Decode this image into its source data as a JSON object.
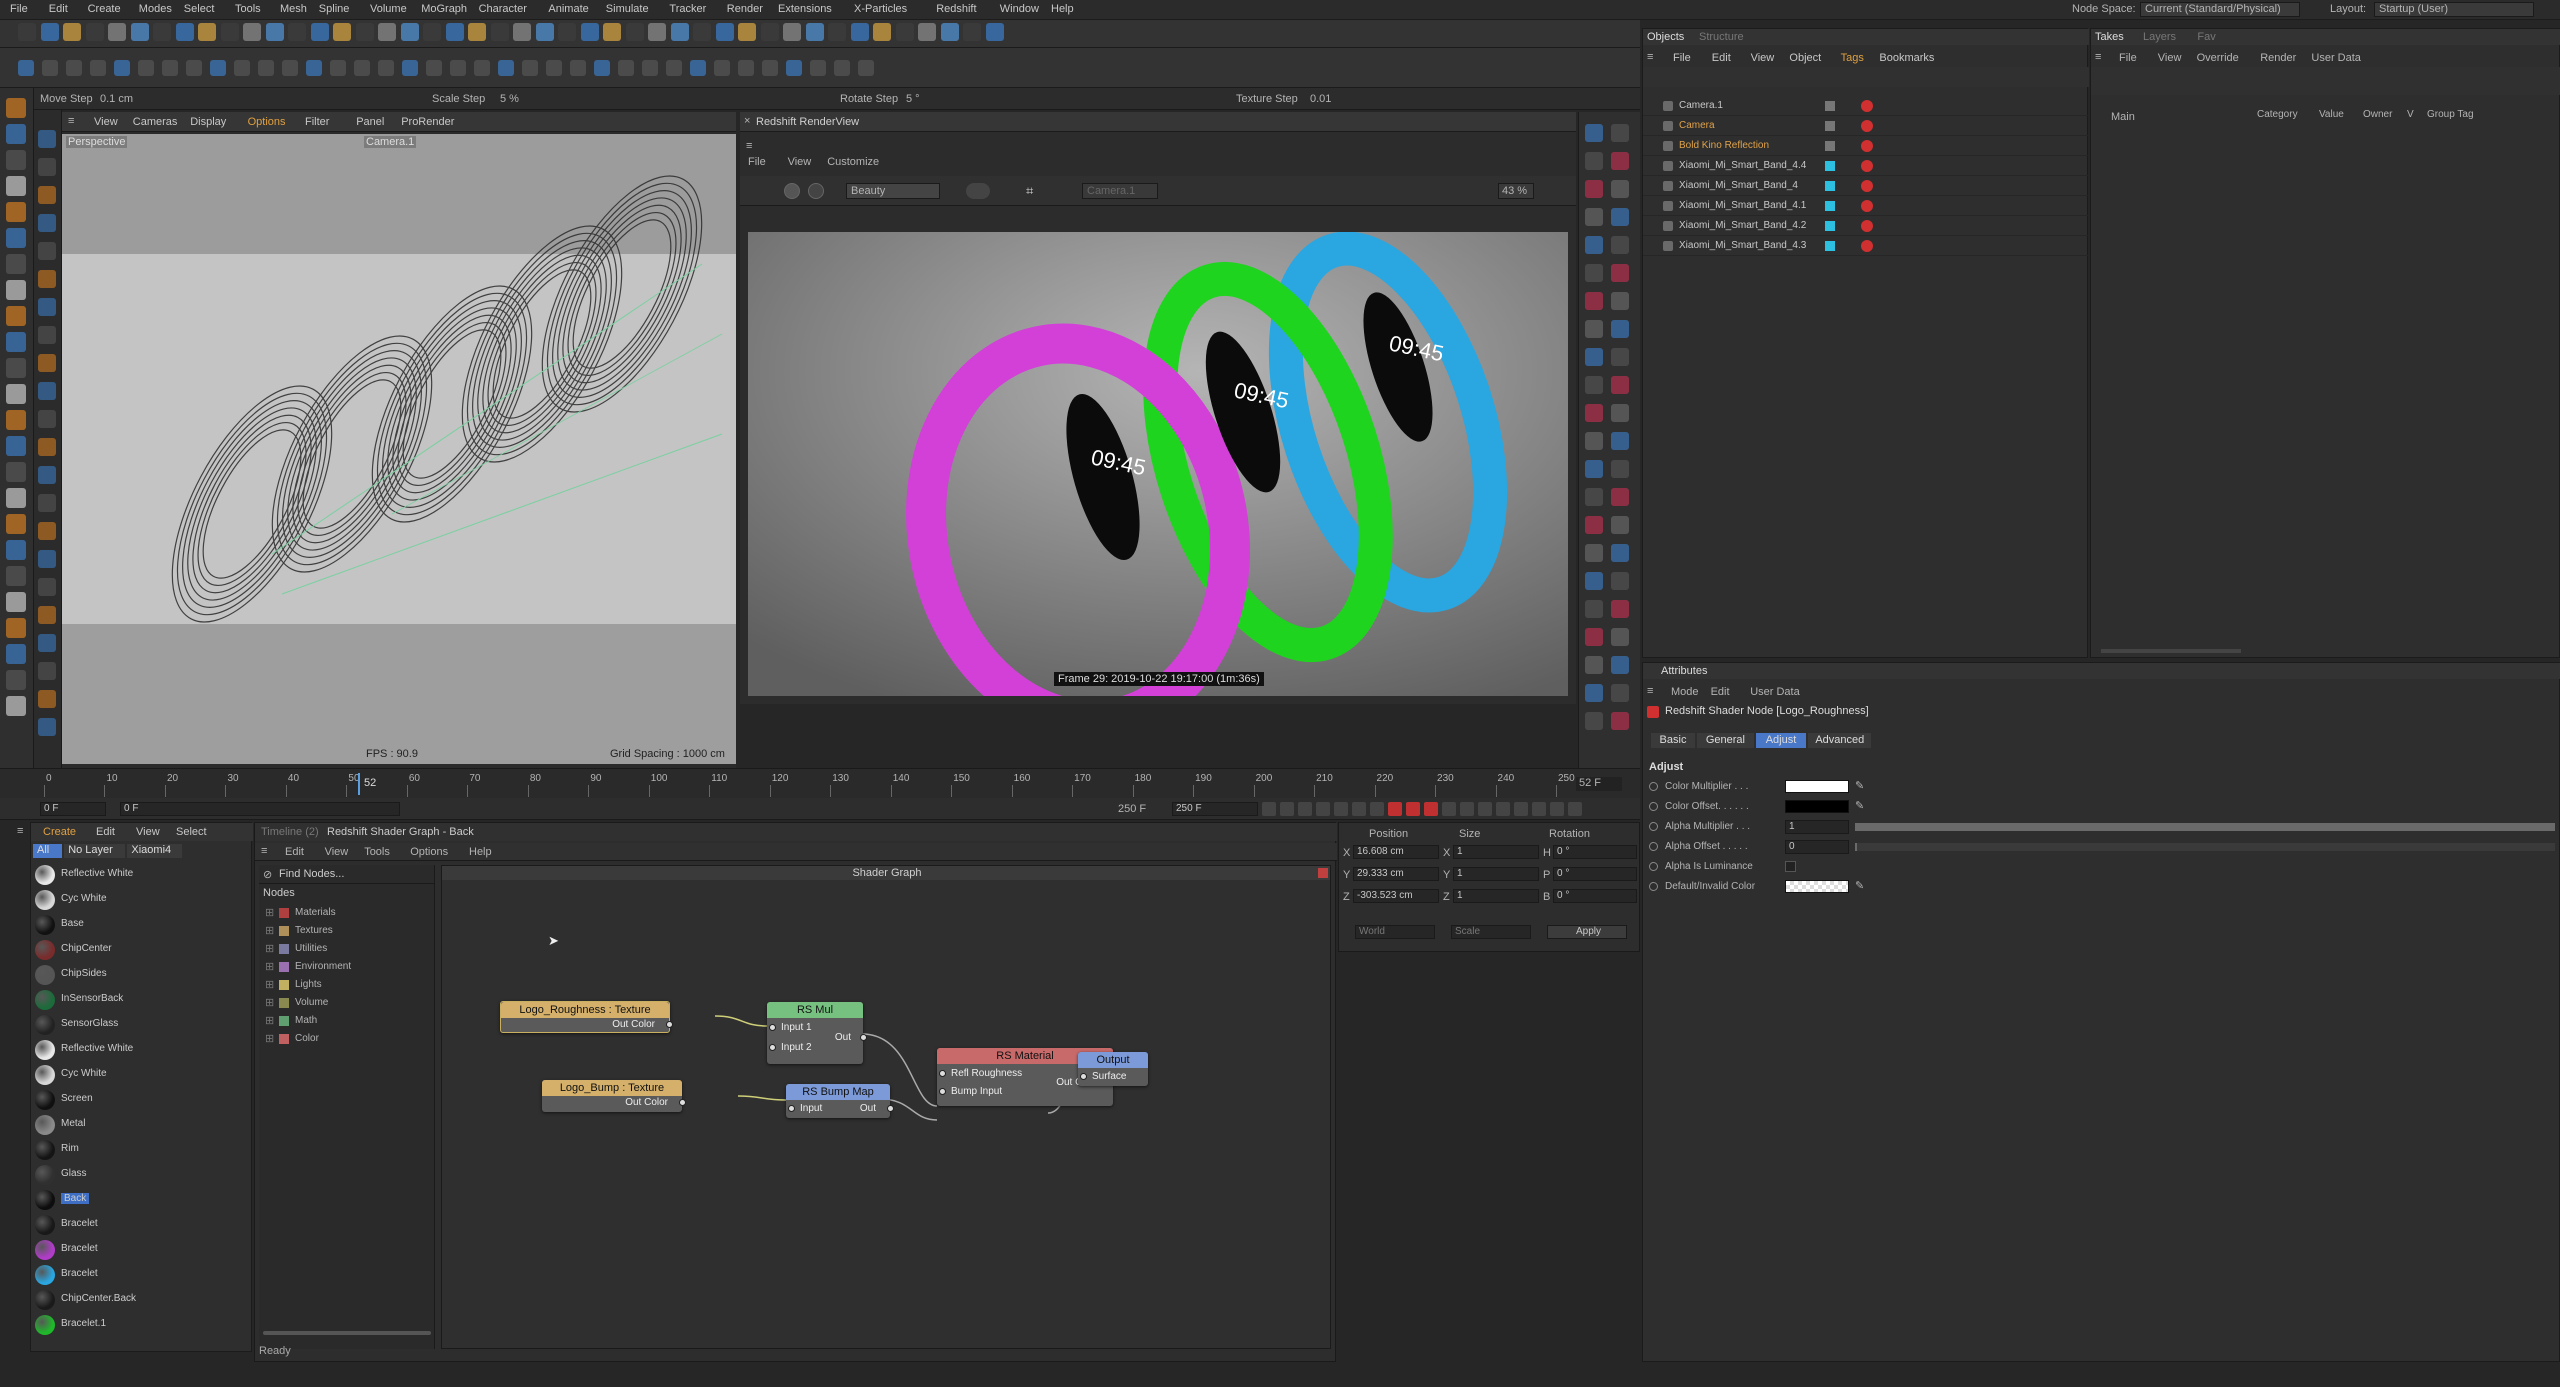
{
  "menu": [
    "File",
    "Edit",
    "Create",
    "Modes",
    "Select",
    "Tools",
    "Mesh",
    "Spline",
    "Volume",
    "MoGraph",
    "Character",
    "Animate",
    "Simulate",
    "Tracker",
    "Render",
    "Extensions",
    "X-Particles",
    "Redshift",
    "Window",
    "Help"
  ],
  "node_space": {
    "label": "Node Space:",
    "value": "Current (Standard/Physical)"
  },
  "layout": {
    "label": "Layout:",
    "value": "Startup (User)"
  },
  "steps": {
    "move": "Move Step",
    "move_val": "0.1 cm",
    "scale": "Scale Step",
    "scale_val": "5 %",
    "rotate": "Rotate Step",
    "rotate_val": "5 °",
    "texture": "Texture Step",
    "texture_val": "0.01"
  },
  "viewport": {
    "menu": [
      "View",
      "Cameras",
      "Display",
      "Options",
      "Filter",
      "Panel",
      "ProRender"
    ],
    "mode": "Perspective",
    "camera": "Camera.1",
    "fps": "FPS : 90.9",
    "grid": "Grid Spacing : 1000 cm"
  },
  "renderview": {
    "title": "Redshift RenderView",
    "menu": [
      "File",
      "View",
      "Customize"
    ],
    "aov": "Beauty",
    "camera": "Camera.1",
    "zoom": "43 %",
    "frame_info": "Frame 29: 2019-10-22 19:17:00 (1m:36s)"
  },
  "timeline": {
    "ticks": [
      "0",
      "10",
      "20",
      "30",
      "40",
      "50",
      "60",
      "70",
      "80",
      "90",
      "100",
      "110",
      "120",
      "130",
      "140",
      "150",
      "160",
      "170",
      "180",
      "190",
      "200",
      "210",
      "220",
      "230",
      "240",
      "250"
    ],
    "current": "52",
    "frame_display": "52 F",
    "start": "0 F",
    "start2": "0 F",
    "end": "250 F",
    "end2": "250 F"
  },
  "materials": {
    "tabs": [
      "Create",
      "Edit",
      "View",
      "Select"
    ],
    "filters": [
      "All",
      "No Layer",
      "Xiaomi4"
    ],
    "items": [
      {
        "name": "Reflective White",
        "color": "#e8e8e8"
      },
      {
        "name": "Cyc White",
        "color": "#d8d8d8"
      },
      {
        "name": "Base",
        "color": "#111111"
      },
      {
        "name": "ChipCenter",
        "color": "#7a2b2b"
      },
      {
        "name": "ChipSides",
        "color": "#555555"
      },
      {
        "name": "InSensorBack",
        "color": "#1c6b3a"
      },
      {
        "name": "SensorGlass",
        "color": "#222222"
      },
      {
        "name": "Reflective White",
        "color": "#e8e8e8"
      },
      {
        "name": "Cyc White",
        "color": "#d8d8d8"
      },
      {
        "name": "Screen",
        "color": "#101010"
      },
      {
        "name": "Metal",
        "color": "#8a8a8a"
      },
      {
        "name": "Rim",
        "color": "#141414"
      },
      {
        "name": "Glass",
        "color": "#303030"
      },
      {
        "name": "Back",
        "color": "#0d0d0d"
      },
      {
        "name": "Bracelet",
        "color": "#181818"
      },
      {
        "name": "Bracelet",
        "color": "#b03cc8"
      },
      {
        "name": "Bracelet",
        "color": "#2aa6e0"
      },
      {
        "name": "ChipCenter.Back",
        "color": "#1a1a1a"
      },
      {
        "name": "Bracelet.1",
        "color": "#1fb82a"
      }
    ]
  },
  "shader": {
    "tabs": [
      "Timeline (2)",
      "Redshift Shader Graph - Back"
    ],
    "menu": [
      "Edit",
      "View",
      "Tools",
      "Options",
      "Help"
    ],
    "find": "Find Nodes...",
    "nodes_label": "Nodes",
    "categories": [
      {
        "name": "Materials",
        "color": "#b04040"
      },
      {
        "name": "Textures",
        "color": "#b0905a"
      },
      {
        "name": "Utilities",
        "color": "#7a7aa0"
      },
      {
        "name": "Environment",
        "color": "#9a70b0"
      },
      {
        "name": "Lights",
        "color": "#c0b060"
      },
      {
        "name": "Volume",
        "color": "#8a8a50"
      },
      {
        "name": "Math",
        "color": "#60a070"
      },
      {
        "name": "Color",
        "color": "#c06060"
      }
    ],
    "graph_title": "Shader Graph",
    "status": "Ready",
    "nodes": {
      "logo_rough": {
        "title": "Logo_Roughness : Texture",
        "port": "Out Color"
      },
      "rsmul": {
        "title": "RS Mul",
        "in1": "Input 1",
        "in2": "Input 2",
        "out": "Out"
      },
      "material": {
        "title": "RS Material",
        "in1": "Refl Roughness",
        "in2": "Bump Input",
        "out": "Out Color"
      },
      "output": {
        "title": "Output",
        "in1": "Surface"
      },
      "logo_bump": {
        "title": "Logo_Bump : Texture",
        "port": "Out Color"
      },
      "bumpmap": {
        "title": "RS Bump Map",
        "in1": "Input",
        "out": "Out"
      }
    }
  },
  "coords": {
    "headers": [
      "Position",
      "Size",
      "Rotation"
    ],
    "rows": [
      {
        "a": "X",
        "pos": "16.608 cm",
        "b": "X",
        "size": "1",
        "c": "H",
        "rot": "0 °"
      },
      {
        "a": "Y",
        "pos": "29.333 cm",
        "b": "Y",
        "size": "1",
        "c": "P",
        "rot": "0 °"
      },
      {
        "a": "Z",
        "pos": "-303.523 cm",
        "b": "Z",
        "size": "1",
        "c": "B",
        "rot": "0 °"
      }
    ],
    "world": "World",
    "scale": "Scale",
    "apply": "Apply"
  },
  "objects": {
    "tabs": [
      "Objects",
      "Structure"
    ],
    "menu": [
      "File",
      "Edit",
      "View",
      "Object",
      "Tags",
      "Bookmarks"
    ],
    "items": [
      {
        "name": "Camera.1",
        "color": "#c8c8c8"
      },
      {
        "name": "Camera",
        "color": "#e0a24a"
      },
      {
        "name": "Bold Kino Reflection",
        "color": "#e0a24a"
      },
      {
        "name": "Xiaomi_Mi_Smart_Band_4.4",
        "color": "#c8c8c8"
      },
      {
        "name": "Xiaomi_Mi_Smart_Band_4",
        "color": "#c8c8c8"
      },
      {
        "name": "Xiaomi_Mi_Smart_Band_4.1",
        "color": "#c8c8c8"
      },
      {
        "name": "Xiaomi_Mi_Smart_Band_4.2",
        "color": "#c8c8c8"
      },
      {
        "name": "Xiaomi_Mi_Smart_Band_4.3",
        "color": "#c8c8c8"
      }
    ]
  },
  "takes": {
    "tabs": [
      "Takes",
      "Layers",
      "Fav"
    ],
    "menu": [
      "File",
      "View",
      "Override",
      "Render",
      "User Data"
    ],
    "main": "Main",
    "cols": [
      "Category",
      "Value",
      "Owner",
      "V",
      "Group Tag"
    ]
  },
  "attributes": {
    "tab": "Attributes",
    "menu": [
      "Mode",
      "Edit",
      "User Data"
    ],
    "node_title": "Redshift Shader Node [Logo_Roughness]",
    "tabs": [
      "Basic",
      "General",
      "Adjust",
      "Advanced"
    ],
    "section": "Adjust",
    "fields": [
      {
        "label": "Color Multiplier . . .",
        "kind": "color",
        "value": "#ffffff"
      },
      {
        "label": "Color Offset. . . . . .",
        "kind": "color",
        "value": "#000000"
      },
      {
        "label": "Alpha Multiplier . . .",
        "kind": "slider",
        "value": "1"
      },
      {
        "label": "Alpha Offset . . . . .",
        "kind": "slider",
        "value": "0"
      },
      {
        "label": "Alpha Is Luminance",
        "kind": "check",
        "value": ""
      },
      {
        "label": "Default/Invalid Color",
        "kind": "checker",
        "value": ""
      }
    ]
  }
}
